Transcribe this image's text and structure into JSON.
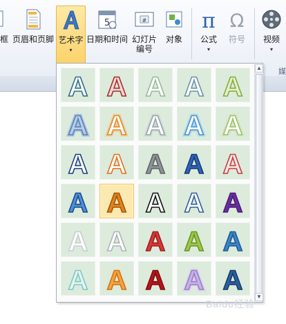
{
  "ribbon": {
    "buttons": [
      {
        "id": "textbox",
        "label": "框",
        "icon": "textbox-icon"
      },
      {
        "id": "header-footer",
        "label": "页眉和页脚",
        "icon": "header-footer-icon"
      },
      {
        "id": "wordart",
        "label": "艺术字",
        "icon": "wordart-icon",
        "active": true,
        "has_dropdown": true
      },
      {
        "id": "datetime",
        "label": "日期和时间",
        "icon": "calendar-icon"
      },
      {
        "id": "slide-number",
        "label": "幻灯片",
        "label2": "编号",
        "icon": "slide-number-icon"
      },
      {
        "id": "object",
        "label": "对象",
        "icon": "object-icon"
      },
      {
        "id": "equation",
        "label": "公式",
        "icon": "pi-icon",
        "has_dropdown": true
      },
      {
        "id": "symbol",
        "label": "符号",
        "icon": "omega-icon",
        "disabled": true
      },
      {
        "id": "video",
        "label": "视频",
        "icon": "film-icon",
        "has_dropdown": true
      }
    ],
    "partial_group_label": "媒"
  },
  "gallery": {
    "letter": "A",
    "styles": [
      {
        "name": "style-1-1",
        "fill": "#ffffff",
        "stroke": "#2f6d8a",
        "glow": ""
      },
      {
        "name": "style-1-2",
        "fill": "#f6d7d4",
        "stroke": "#a5302c",
        "glow": ""
      },
      {
        "name": "style-1-3",
        "fill": "#ffffff",
        "stroke": "#9bb79b",
        "glow": ""
      },
      {
        "name": "style-1-4",
        "fill": "#ffffff",
        "stroke": "#6c93a8",
        "glow": ""
      },
      {
        "name": "style-1-5",
        "fill": "#e3f0c9",
        "stroke": "#86ab3e",
        "glow": ""
      },
      {
        "name": "style-2-1",
        "fill": "#b7cde8",
        "stroke": "#5a82b6",
        "glow": "#8fb1dc"
      },
      {
        "name": "style-2-2",
        "fill": "#ffffff",
        "stroke": "#e08a2a",
        "glow": "#f6c27a"
      },
      {
        "name": "style-2-3",
        "fill": "#ffffff",
        "stroke": "#9aa6a8",
        "glow": "#c9d2d4"
      },
      {
        "name": "style-2-4",
        "fill": "#ffffff",
        "stroke": "#4a96d4",
        "glow": "#9bcdf0"
      },
      {
        "name": "style-2-5",
        "fill": "#ffffff",
        "stroke": "#9cc06a",
        "glow": "#d0e6b0"
      },
      {
        "name": "style-3-1",
        "fill": "#ffffff",
        "stroke": "#1c3f7e",
        "glow": ""
      },
      {
        "name": "style-3-2",
        "fill": "#ffffff",
        "stroke": "#e56f16",
        "glow": ""
      },
      {
        "name": "style-3-3",
        "fill": "#8e9396",
        "stroke": "#5f6568",
        "glow": ""
      },
      {
        "name": "style-3-4",
        "fill": "#2f63b8",
        "stroke": "#173b78",
        "glow": ""
      },
      {
        "name": "style-3-5",
        "fill": "#fbe4e4",
        "stroke": "#c24141",
        "glow": ""
      },
      {
        "name": "style-4-1",
        "fill": "#4f8fd6",
        "stroke": "#1b4c8c",
        "glow": ""
      },
      {
        "name": "style-4-2",
        "fill": "#e08420",
        "stroke": "#a35608",
        "glow": ""
      },
      {
        "name": "style-4-3",
        "fill": "#ffffff",
        "stroke": "#111111",
        "glow": ""
      },
      {
        "name": "style-4-4",
        "fill": "#ffffff",
        "stroke": "#305f9c",
        "glow": ""
      },
      {
        "name": "style-4-5",
        "fill": "#6a2f9e",
        "stroke": "#4a1a78",
        "glow": ""
      },
      {
        "name": "style-5-1",
        "fill": "#ffffff",
        "stroke": "#c9cdd0",
        "glow": ""
      },
      {
        "name": "style-5-2",
        "fill": "#ffffff",
        "stroke": "#aeb3b6",
        "glow": ""
      },
      {
        "name": "style-5-3",
        "fill": "#d93838",
        "stroke": "#9c1e1e",
        "glow": ""
      },
      {
        "name": "style-5-4",
        "fill": "#9cc84a",
        "stroke": "#6b9424",
        "glow": ""
      },
      {
        "name": "style-5-5",
        "fill": "#3b84c8",
        "stroke": "#1e5a96",
        "glow": ""
      },
      {
        "name": "style-6-1",
        "fill": "#e5f4f2",
        "stroke": "#7ec8c4",
        "glow": ""
      },
      {
        "name": "style-6-2",
        "fill": "#f7a340",
        "stroke": "#d07412",
        "glow": ""
      },
      {
        "name": "style-6-3",
        "fill": "#b8151a",
        "stroke": "#7e0d10",
        "glow": ""
      },
      {
        "name": "style-6-4",
        "fill": "#c7b2e6",
        "stroke": "#9a7ec8",
        "glow": "#d9c8f0"
      },
      {
        "name": "style-6-5",
        "fill": "#2d5f9c",
        "stroke": "#163c6a",
        "glow": ""
      }
    ],
    "selected_index": 16
  },
  "watermark": "Baidu经验",
  "colors": {
    "accent": "#fbd36a",
    "tile_bg": "#dcebdc"
  }
}
